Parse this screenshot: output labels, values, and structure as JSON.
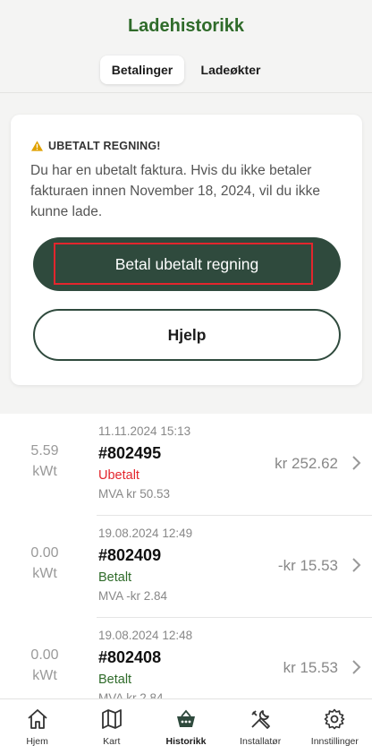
{
  "header": {
    "title": "Ladehistorikk",
    "tabs": [
      {
        "label": "Betalinger",
        "active": true
      },
      {
        "label": "Ladeøkter",
        "active": false
      }
    ]
  },
  "notice": {
    "title": "UBETALT REGNING!",
    "text": "Du har en ubetalt faktura. Hvis du ikke betaler fakturaen innen November 18, 2024, vil du ikke kunne lade.",
    "pay_button": "Betal ubetalt regning",
    "help_button": "Hjelp"
  },
  "transactions": [
    {
      "kwt_value": "5.59",
      "kwt_unit": "kWt",
      "timestamp": "11.11.2024 15:13",
      "invoice": "#802495",
      "status": "Ubetalt",
      "vat": "MVA kr 50.53",
      "amount": "kr 252.62"
    },
    {
      "kwt_value": "0.00",
      "kwt_unit": "kWt",
      "timestamp": "19.08.2024 12:49",
      "invoice": "#802409",
      "status": "Betalt",
      "vat": "MVA -kr 2.84",
      "amount": "-kr 15.53"
    },
    {
      "kwt_value": "0.00",
      "kwt_unit": "kWt",
      "timestamp": "19.08.2024 12:48",
      "invoice": "#802408",
      "status": "Betalt",
      "vat": "MVA kr 2.84",
      "amount": "kr 15.53"
    }
  ],
  "tabbar": [
    {
      "label": "Hjem",
      "icon": "home-icon"
    },
    {
      "label": "Kart",
      "icon": "map-icon"
    },
    {
      "label": "Historikk",
      "icon": "basket-icon"
    },
    {
      "label": "Installatør",
      "icon": "tools-icon"
    },
    {
      "label": "Innstillinger",
      "icon": "gear-icon"
    }
  ],
  "colors": {
    "brand_green": "#2f6b2a",
    "button_dark": "#2f4a3d",
    "unpaid_red": "#e3262d"
  }
}
